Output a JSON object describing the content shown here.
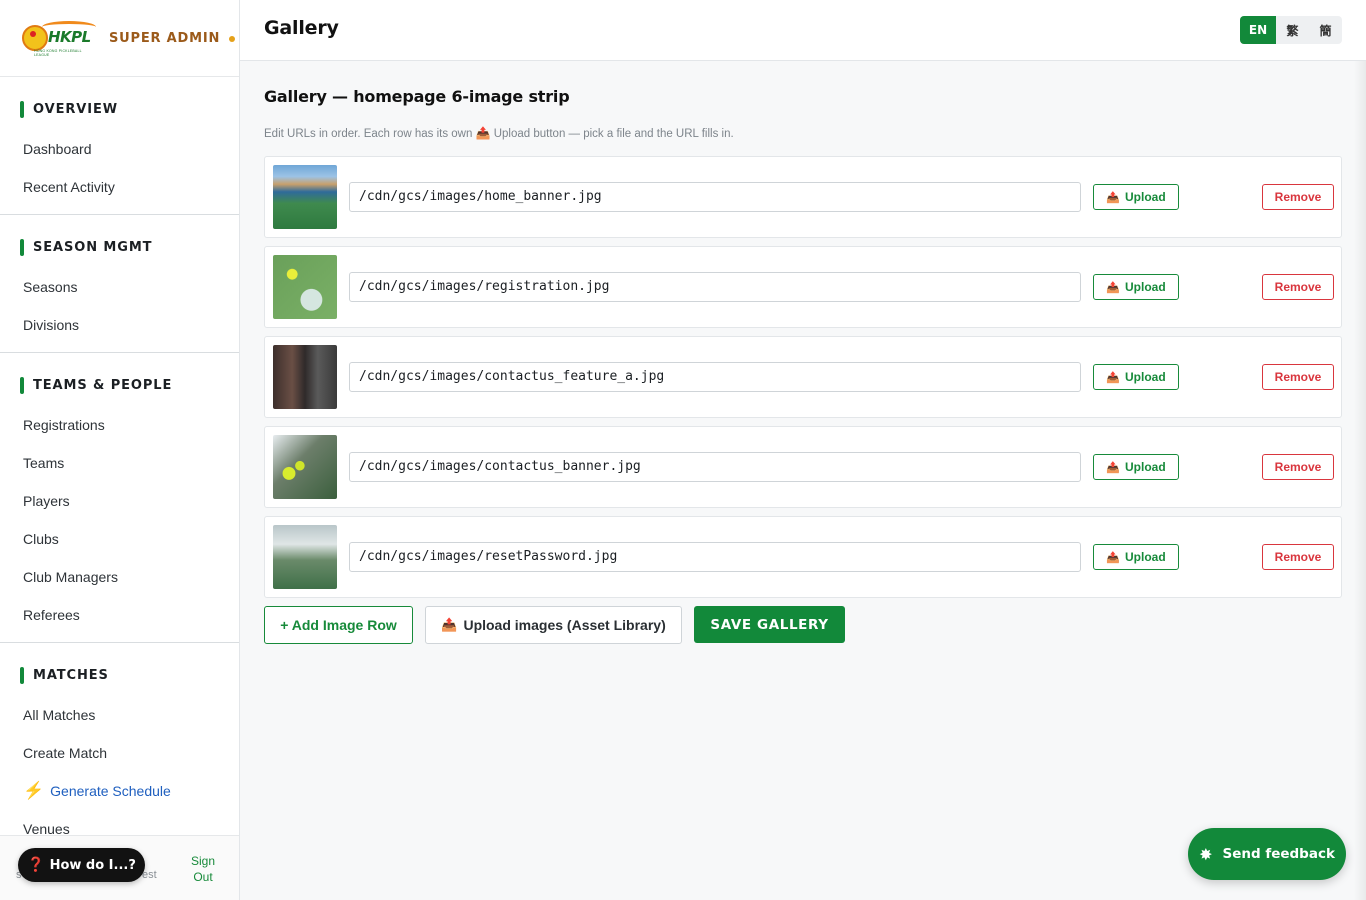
{
  "brand": {
    "logo_text": "HKPL",
    "logo_subtext": "HONG KONG PICKLEBALL LEAGUE",
    "role": "SUPER ADMIN"
  },
  "sidebar": {
    "sections": [
      {
        "title": "OVERVIEW",
        "items": [
          "Dashboard",
          "Recent Activity"
        ]
      },
      {
        "title": "SEASON MGMT",
        "items": [
          "Seasons",
          "Divisions"
        ]
      },
      {
        "title": "TEAMS & PEOPLE",
        "items": [
          "Registrations",
          "Teams",
          "Players",
          "Clubs",
          "Club Managers",
          "Referees"
        ]
      },
      {
        "title": "MATCHES",
        "items": [
          "All Matches",
          "Create Match",
          "Generate Schedule",
          "Venues"
        ]
      }
    ],
    "footer": {
      "user_left": "s",
      "user_right": "est",
      "sign_out": "Sign Out"
    },
    "help_button": "How do I...?"
  },
  "header": {
    "title": "Gallery",
    "languages": [
      {
        "label": "EN",
        "active": true
      },
      {
        "label": "繁",
        "active": false
      },
      {
        "label": "簡",
        "active": false
      }
    ]
  },
  "main": {
    "section_title": "Gallery — homepage 6-image strip",
    "hint": "Edit URLs in order. Each row has its own",
    "hint_button_ref": "Upload button — pick a file and the URL fills in.",
    "rows": [
      {
        "url": "/cdn/gcs/images/home_banner.jpg"
      },
      {
        "url": "/cdn/gcs/images/registration.jpg"
      },
      {
        "url": "/cdn/gcs/images/contactus_feature_a.jpg"
      },
      {
        "url": "/cdn/gcs/images/contactus_banner.jpg"
      },
      {
        "url": "/cdn/gcs/images/resetPassword.jpg"
      }
    ],
    "upload_label": "Upload",
    "remove_label": "Remove",
    "add_row_label": "+ Add Image Row",
    "asset_library_label": "Upload images (Asset Library)",
    "save_label": "SAVE GALLERY"
  },
  "feedback_label": "Send feedback",
  "colors": {
    "accent": "#12893a",
    "danger": "#d9363e",
    "link": "#1f5fbf",
    "brand_role": "#9b5a1a"
  }
}
